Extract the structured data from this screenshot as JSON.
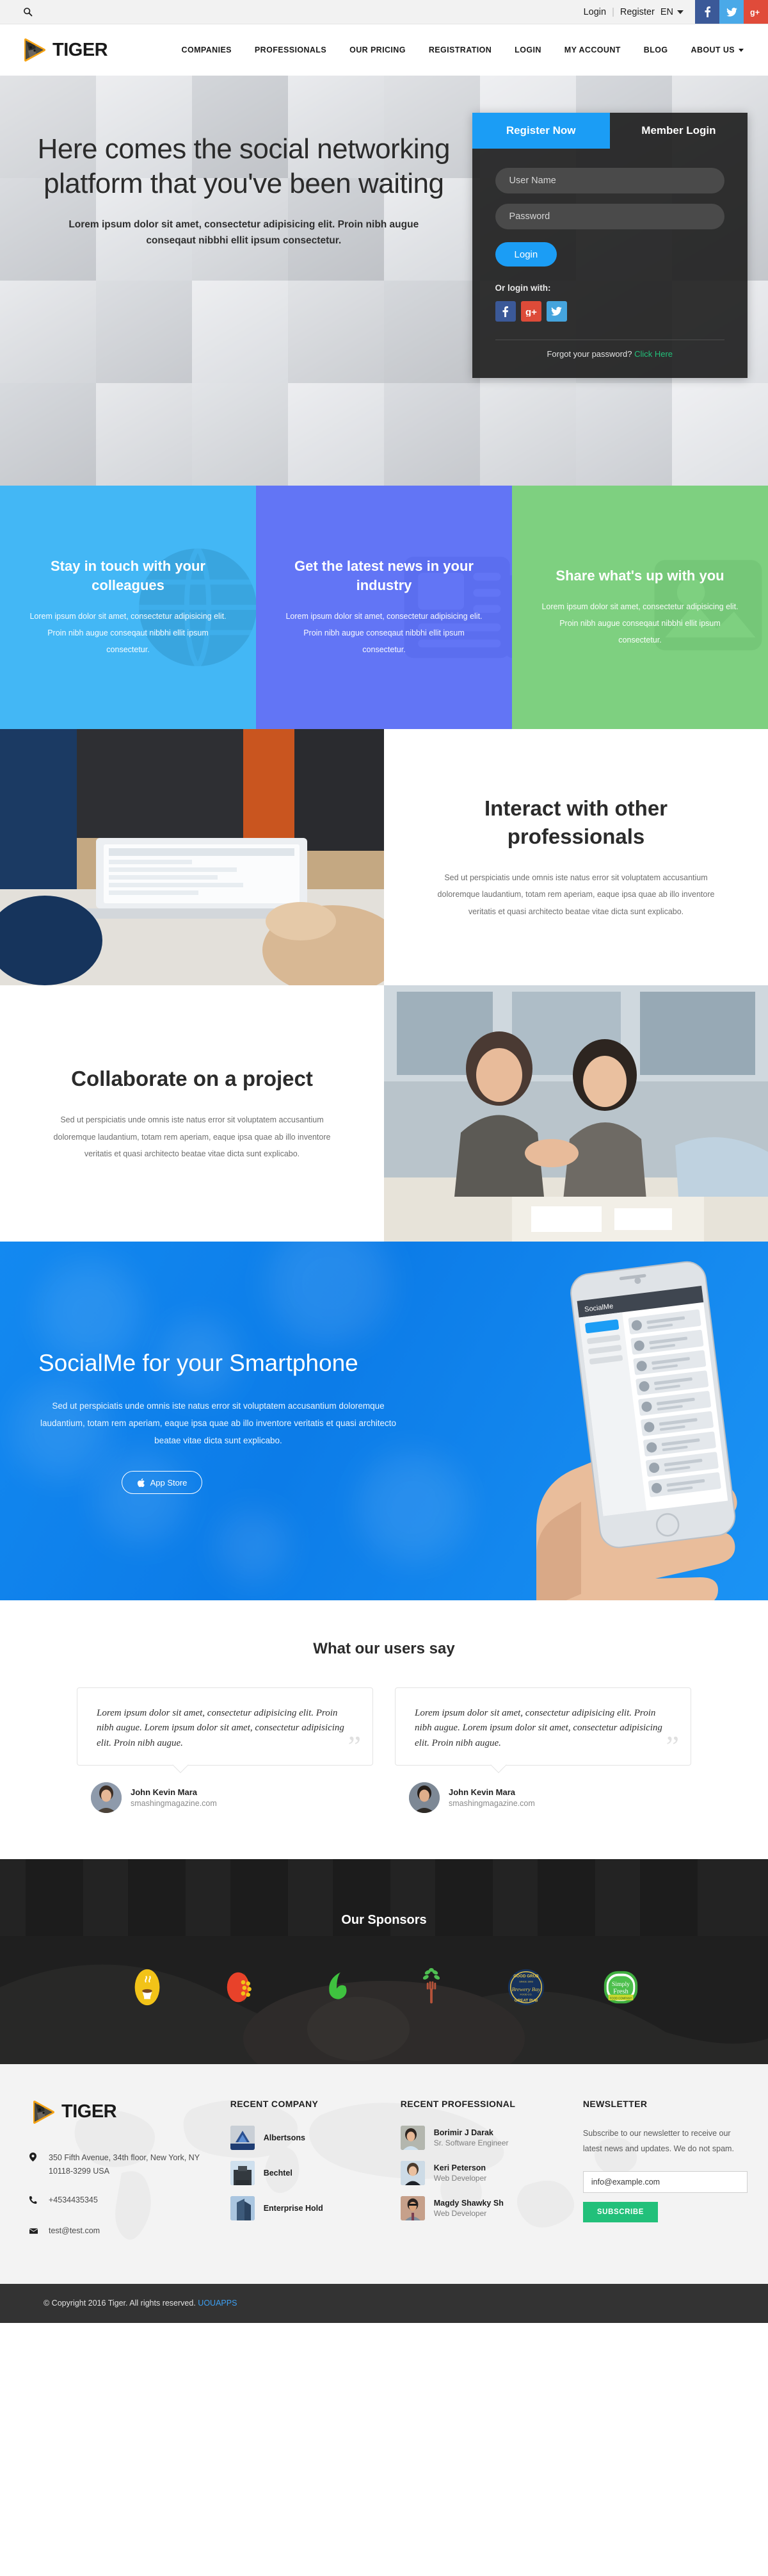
{
  "topbar": {
    "search_icon": "search-icon",
    "login": "Login",
    "separator": "|",
    "register": "Register",
    "language": "EN",
    "socials": [
      {
        "name": "facebook-icon",
        "glyph": "f",
        "color": "#3b5998"
      },
      {
        "name": "twitter-icon",
        "glyph": "ᵗ",
        "color": "#4aa9e8"
      },
      {
        "name": "googleplus-icon",
        "glyph": "g+",
        "color": "#e04b3a"
      }
    ]
  },
  "header": {
    "brand": "TIGER",
    "nav": [
      {
        "label": "COMPANIES",
        "caret": false
      },
      {
        "label": "PROFESSIONALS",
        "caret": false
      },
      {
        "label": "OUR PRICING",
        "caret": false
      },
      {
        "label": "REGISTRATION",
        "caret": false
      },
      {
        "label": "LOGIN",
        "caret": false
      },
      {
        "label": "MY ACCOUNT",
        "caret": false
      },
      {
        "label": "BLOG",
        "caret": false
      },
      {
        "label": "ABOUT US",
        "caret": true
      }
    ]
  },
  "hero": {
    "title": "Here comes the social networking platform that you've been waiting",
    "subtitle": "Lorem ipsum dolor sit amet, consectetur adipisicing elit. Proin nibh augue conseqaut nibbhi ellit ipsum consectetur.",
    "login_card": {
      "tab_register": "Register Now",
      "tab_member": "Member Login",
      "username_placeholder": "User Name",
      "password_placeholder": "Password",
      "login_button": "Login",
      "or_login_with": "Or login with:",
      "socials": [
        {
          "name": "facebook-icon",
          "glyph": "f",
          "color": "#3b5998"
        },
        {
          "name": "googleplus-icon",
          "glyph": "g+",
          "color": "#dd4b39"
        },
        {
          "name": "twitter-icon",
          "glyph": "ᵗ",
          "color": "#45a4dd"
        }
      ],
      "forgot_text": "Forgot your password?",
      "forgot_link": "Click Here"
    }
  },
  "panels": [
    {
      "title": "Stay in touch with your colleagues",
      "body": "Lorem ipsum dolor sit amet, consectetur adipisicing elit. Proin nibh augue conseqaut nibbhi ellit ipsum consectetur.",
      "color": "#43b7f5",
      "icon": "globe-icon"
    },
    {
      "title": "Get the latest news in your industry",
      "body": "Lorem ipsum dolor sit amet, consectetur adipisicing elit. Proin nibh augue conseqaut nibbhi ellit ipsum consectetur.",
      "color": "#6275f5",
      "icon": "newspaper-icon"
    },
    {
      "title": "Share what's up with you",
      "body": "Lorem ipsum dolor sit amet, consectetur adipisicing elit. Proin nibh augue conseqaut nibbhi ellit ipsum consectetur.",
      "color": "#7ed080",
      "icon": "image-icon"
    }
  ],
  "splits": [
    {
      "title": "Interact with other professionals",
      "body": "Sed ut perspiciatis unde omnis iste natus error sit voluptatem accusantium doloremque laudantium, totam rem aperiam, eaque ipsa quae ab illo inventore veritatis et quasi architecto beatae vitae dicta sunt explicabo.",
      "image": "laptop-desk-photo",
      "image_side": "left"
    },
    {
      "title": "Collaborate on a project",
      "body": "Sed ut perspiciatis unde omnis iste natus error sit voluptatem accusantium doloremque laudantium, totam rem aperiam, eaque ipsa quae ab illo inventore veritatis et quasi architecto beatae vitae dicta sunt explicabo.",
      "image": "handshake-meeting-photo",
      "image_side": "right"
    }
  ],
  "app": {
    "title": "SocialMe for your Smartphone",
    "body": "Sed ut perspiciatis unde omnis iste natus error sit voluptatem accusantium doloremque laudantium, totam rem aperiam, eaque ipsa quae ab illo inventore veritatis et quasi architecto beatae vitae dicta sunt explicabo.",
    "button": "App Store",
    "button_icon": "apple-icon",
    "phone_header": "SocialMe"
  },
  "testimonials": {
    "heading": "What our users say",
    "items": [
      {
        "quote": "Lorem ipsum dolor sit amet, consectetur adipisicing elit. Proin nibh augue. Lorem ipsum dolor sit amet, consectetur adipisicing elit. Proin nibh augue.",
        "name": "John Kevin Mara",
        "site": "smashingmagazine.com"
      },
      {
        "quote": "Lorem ipsum dolor sit amet, consectetur adipisicing elit. Proin nibh augue. Lorem ipsum dolor sit amet, consectetur adipisicing elit. Proin nibh augue.",
        "name": "John Kevin Mara",
        "site": "smashingmagazine.com"
      }
    ]
  },
  "sponsors": {
    "heading": "Our Sponsors",
    "logos": [
      {
        "name": "coffee-cup-logo",
        "label": "Coffee"
      },
      {
        "name": "red-honeycomb-logo",
        "label": "Honeycomb"
      },
      {
        "name": "green-leaf-six-logo",
        "label": "Leaf Six"
      },
      {
        "name": "fork-plant-logo",
        "label": "Fork Plant"
      },
      {
        "name": "brewery-bay-logo",
        "label": "GOOD GRUB Brewery Bay GREAT PUB"
      },
      {
        "name": "simply-fresh-logo",
        "label": "Simply Fresh Food Company"
      }
    ]
  },
  "footer": {
    "brand": "TIGER",
    "address": "350 Fifth Avenue, 34th floor, New York, NY 10118-3299 USA",
    "phone": "+4534435345",
    "email": "test@test.com",
    "recent_company": {
      "heading": "RECENT COMPANY",
      "items": [
        {
          "name": "Albertsons"
        },
        {
          "name": "Bechtel"
        },
        {
          "name": "Enterprise Hold"
        }
      ]
    },
    "recent_professional": {
      "heading": "RECENT PROFESSIONAL",
      "items": [
        {
          "name": "Borimir J Darak",
          "role": "Sr. Software Engineer"
        },
        {
          "name": "Keri Peterson",
          "role": "Web Developer"
        },
        {
          "name": "Magdy Shawky Sh",
          "role": "Web Developer"
        }
      ]
    },
    "newsletter": {
      "heading": "NEWSLETTER",
      "text": "Subscribe to our newsletter to receive our latest news and updates. We do not spam.",
      "email_value": "info@example.com",
      "button": "SUBSCRIBE"
    }
  },
  "copyright": {
    "text": "© Copyright 2016 Tiger. All rights reserved.",
    "link": "UOUAPPS"
  }
}
